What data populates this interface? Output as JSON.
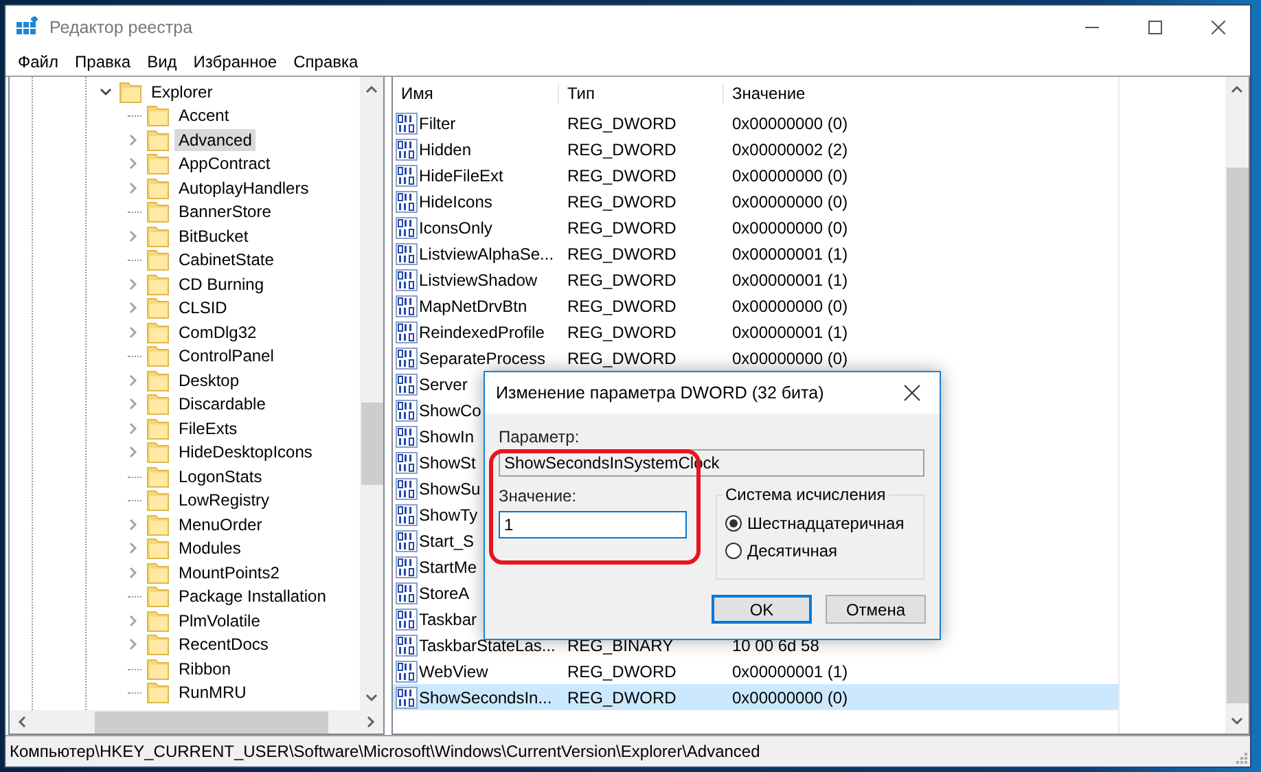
{
  "window": {
    "title": "Редактор реестра"
  },
  "menu": [
    "Файл",
    "Правка",
    "Вид",
    "Избранное",
    "Справка"
  ],
  "tree": {
    "items": [
      {
        "label": "Explorer",
        "expandable": true,
        "expanded": true,
        "selected": false,
        "children": [
          {
            "label": "Accent",
            "expandable": false,
            "selected": false
          },
          {
            "label": "Advanced",
            "expandable": true,
            "selected": true
          },
          {
            "label": "AppContract",
            "expandable": true,
            "selected": false
          },
          {
            "label": "AutoplayHandlers",
            "expandable": true,
            "selected": false
          },
          {
            "label": "BannerStore",
            "expandable": false,
            "selected": false
          },
          {
            "label": "BitBucket",
            "expandable": true,
            "selected": false
          },
          {
            "label": "CabinetState",
            "expandable": false,
            "selected": false
          },
          {
            "label": "CD Burning",
            "expandable": true,
            "selected": false
          },
          {
            "label": "CLSID",
            "expandable": true,
            "selected": false
          },
          {
            "label": "ComDlg32",
            "expandable": true,
            "selected": false
          },
          {
            "label": "ControlPanel",
            "expandable": false,
            "selected": false
          },
          {
            "label": "Desktop",
            "expandable": true,
            "selected": false
          },
          {
            "label": "Discardable",
            "expandable": true,
            "selected": false
          },
          {
            "label": "FileExts",
            "expandable": true,
            "selected": false
          },
          {
            "label": "HideDesktopIcons",
            "expandable": true,
            "selected": false
          },
          {
            "label": "LogonStats",
            "expandable": false,
            "selected": false
          },
          {
            "label": "LowRegistry",
            "expandable": false,
            "selected": false
          },
          {
            "label": "MenuOrder",
            "expandable": true,
            "selected": false
          },
          {
            "label": "Modules",
            "expandable": true,
            "selected": false
          },
          {
            "label": "MountPoints2",
            "expandable": true,
            "selected": false
          },
          {
            "label": "Package Installation",
            "expandable": false,
            "selected": false
          },
          {
            "label": "PlmVolatile",
            "expandable": true,
            "selected": false
          },
          {
            "label": "RecentDocs",
            "expandable": true,
            "selected": false
          },
          {
            "label": "Ribbon",
            "expandable": false,
            "selected": false
          },
          {
            "label": "RunMRU",
            "expandable": false,
            "selected": false
          }
        ]
      }
    ]
  },
  "values": {
    "columns": [
      "Имя",
      "Тип",
      "Значение"
    ],
    "rows": [
      {
        "name": "Filter",
        "type": "REG_DWORD",
        "data": "0x00000000 (0)",
        "selected": false
      },
      {
        "name": "Hidden",
        "type": "REG_DWORD",
        "data": "0x00000002 (2)",
        "selected": false
      },
      {
        "name": "HideFileExt",
        "type": "REG_DWORD",
        "data": "0x00000000 (0)",
        "selected": false
      },
      {
        "name": "HideIcons",
        "type": "REG_DWORD",
        "data": "0x00000000 (0)",
        "selected": false
      },
      {
        "name": "IconsOnly",
        "type": "REG_DWORD",
        "data": "0x00000000 (0)",
        "selected": false
      },
      {
        "name": "ListviewAlphaSe...",
        "type": "REG_DWORD",
        "data": "0x00000001 (1)",
        "selected": false
      },
      {
        "name": "ListviewShadow",
        "type": "REG_DWORD",
        "data": "0x00000001 (1)",
        "selected": false
      },
      {
        "name": "MapNetDrvBtn",
        "type": "REG_DWORD",
        "data": "0x00000000 (0)",
        "selected": false
      },
      {
        "name": "ReindexedProfile",
        "type": "REG_DWORD",
        "data": "0x00000001 (1)",
        "selected": false
      },
      {
        "name": "SeparateProcess",
        "type": "REG_DWORD",
        "data": "0x00000000 (0)",
        "selected": false
      },
      {
        "name": "Server",
        "selected": false
      },
      {
        "name": "ShowCo",
        "selected": false
      },
      {
        "name": "ShowIn",
        "selected": false
      },
      {
        "name": "ShowSt",
        "selected": false
      },
      {
        "name": "ShowSu",
        "selected": false
      },
      {
        "name": "ShowTy",
        "selected": false
      },
      {
        "name": "Start_S",
        "selected": false
      },
      {
        "name": "StartMe",
        "selected": false
      },
      {
        "name": "StoreA",
        "selected": false
      },
      {
        "name": "Taskbar",
        "selected": false
      },
      {
        "name": "TaskbarStateLas...",
        "type": "REG_BINARY",
        "data": "10 00 6d 58",
        "selected": false
      },
      {
        "name": "WebView",
        "type": "REG_DWORD",
        "data": "0x00000001 (1)",
        "selected": false
      },
      {
        "name": "ShowSecondsIn...",
        "type": "REG_DWORD",
        "data": "0x00000000 (0)",
        "selected": true
      }
    ]
  },
  "status_bar": "Компьютер\\HKEY_CURRENT_USER\\Software\\Microsoft\\Windows\\CurrentVersion\\Explorer\\Advanced",
  "dialog": {
    "title": "Изменение параметра DWORD (32 бита)",
    "param_label": "Параметр:",
    "param_value": "ShowSecondsInSystemClock",
    "value_label": "Значение:",
    "value": "1",
    "base_group": "Система исчисления",
    "radios": [
      {
        "label": "Шестнадцатеричная",
        "selected": true
      },
      {
        "label": "Десятичная",
        "selected": false
      }
    ],
    "buttons": [
      {
        "label": "OK",
        "default": true
      },
      {
        "label": "Отмена",
        "default": false
      }
    ]
  }
}
